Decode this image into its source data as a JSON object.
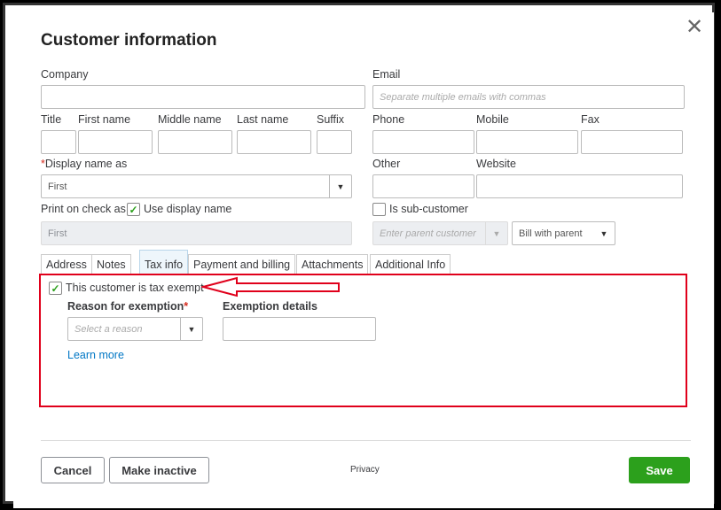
{
  "dialog": {
    "title": "Customer information",
    "close_glyph": "✕"
  },
  "fields": {
    "company_label": "Company",
    "email_label": "Email",
    "email_placeholder": "Separate multiple emails with commas",
    "title_label": "Title",
    "first_name_label": "First name",
    "middle_name_label": "Middle name",
    "last_name_label": "Last name",
    "suffix_label": "Suffix",
    "phone_label": "Phone",
    "mobile_label": "Mobile",
    "fax_label": "Fax",
    "display_name_required": "*",
    "display_name_label": "Display name as",
    "display_name_value": "First",
    "other_label": "Other",
    "website_label": "Website",
    "print_on_check_label": "Print on check as",
    "use_display_name_label": "Use display name",
    "print_on_check_value": "First",
    "sub_customer_label": "Is sub-customer",
    "parent_customer_placeholder": "Enter parent customer",
    "bill_with_value": "Bill with parent"
  },
  "tabs": [
    {
      "label": "Address"
    },
    {
      "label": "Notes"
    },
    {
      "label": "Tax info"
    },
    {
      "label": "Payment and billing"
    },
    {
      "label": "Attachments"
    },
    {
      "label": "Additional Info"
    }
  ],
  "tax_info": {
    "tax_exempt_label": "This customer is tax exempt",
    "tax_exempt_checked": true,
    "reason_label": "Reason for exemption",
    "reason_required": "*",
    "reason_placeholder": "Select a reason",
    "details_label": "Exemption details",
    "learn_more": "Learn more"
  },
  "footer": {
    "cancel": "Cancel",
    "make_inactive": "Make inactive",
    "privacy": "Privacy",
    "save": "Save"
  },
  "colors": {
    "accent_green": "#2ca01c",
    "annotation_red": "#e0001b",
    "link_blue": "#0077c5"
  },
  "icons": {
    "close": "close-icon",
    "dropdown": "chevron-down-icon",
    "check": "checkmark-icon",
    "annotation": "arrow-left-icon"
  }
}
